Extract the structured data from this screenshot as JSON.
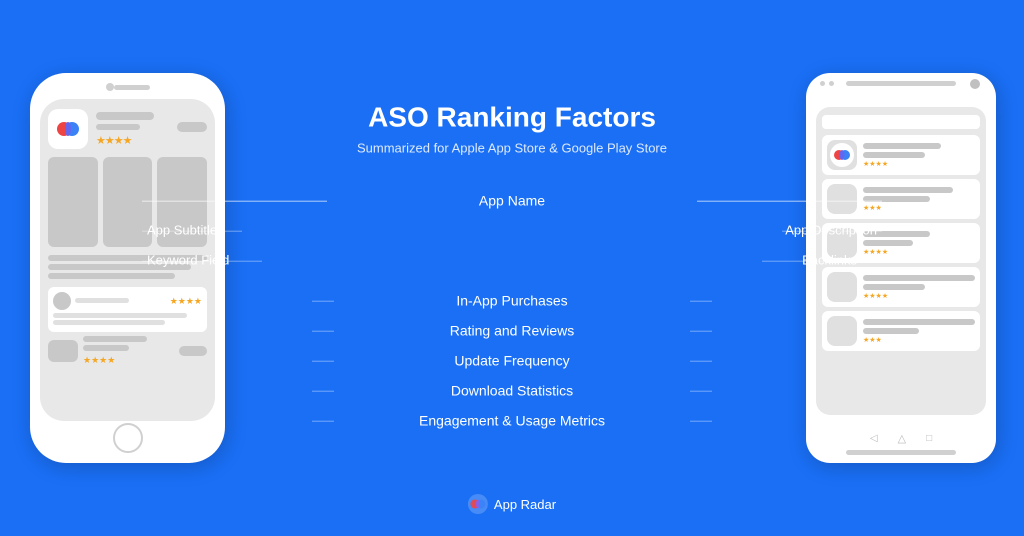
{
  "page": {
    "background_color": "#1a6ff5"
  },
  "header": {
    "title": "ASO Ranking Factors",
    "subtitle": "Summarized for Apple App Store & Google Play Store"
  },
  "factors": {
    "appname_label": "App Name",
    "subtitle_label": "App Subtitle",
    "keyword_label": "Keyword Field",
    "description_label": "App Description",
    "backlinks_label": "Backlinks",
    "inapp_label": "In-App Purchases",
    "rating_label": "Rating and Reviews",
    "update_label": "Update Frequency",
    "download_label": "Download Statistics",
    "engagement_label": "Engagement & Usage Metrics"
  },
  "branding": {
    "name": "App Radar"
  },
  "phone_left": {
    "type": "iphone"
  },
  "phone_right": {
    "type": "android"
  }
}
